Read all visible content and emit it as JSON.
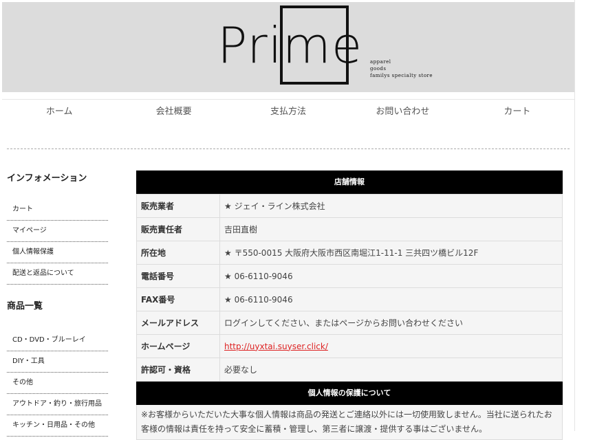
{
  "header": {
    "logo": "Prime",
    "tagline": [
      "apparel",
      "goods",
      "familys specialty store"
    ]
  },
  "nav": [
    "ホーム",
    "会社概要",
    "支払方法",
    "お問い合わせ",
    "カート"
  ],
  "sidebar": {
    "info_title": "インフォメーション",
    "info_items": [
      "カート",
      "マイページ",
      "個人情報保護",
      "配送と返品について"
    ],
    "products_title": "商品一覧",
    "product_items": [
      "CD・DVD・ブルーレイ",
      "DIY・工具",
      "その他",
      "アウトドア・釣り・旅行用品",
      "キッチン・日用品・その他"
    ]
  },
  "store": {
    "heading": "店舗情報",
    "rows": [
      {
        "k": "販売業者",
        "v": "★ ジェイ・ライン株式会社"
      },
      {
        "k": "販売責任者",
        "v": "吉田直樹"
      },
      {
        "k": "所在地",
        "v": "★ 〒550-0015 大阪府大阪市西区南堀江1-11-1 三共四ツ橋ビル12F"
      },
      {
        "k": "電話番号",
        "v": "★ 06-6110-9046"
      },
      {
        "k": "FAX番号",
        "v": "★ 06-6110-9046"
      },
      {
        "k": "メールアドレス",
        "v": "ログインしてください、またはページからお問い合わせください"
      },
      {
        "k": "ホームページ",
        "v": "http://uyxtai.suyser.click/"
      },
      {
        "k": "許認可・資格",
        "v": "必要なし"
      }
    ]
  },
  "privacy": {
    "heading": "個人情報の保護について",
    "text": "※お客様からいただいた大事な個人情報は商品の発送とご連絡以外には一切使用致しません。当社に送られたお客様の情報は責任を持って安全に蓄積・管理し、第三者に譲渡・提供する事はございません。"
  },
  "colors": {
    "header_bg": "#dcdcdc",
    "section_head": "#000000",
    "link": "#dd2222"
  }
}
